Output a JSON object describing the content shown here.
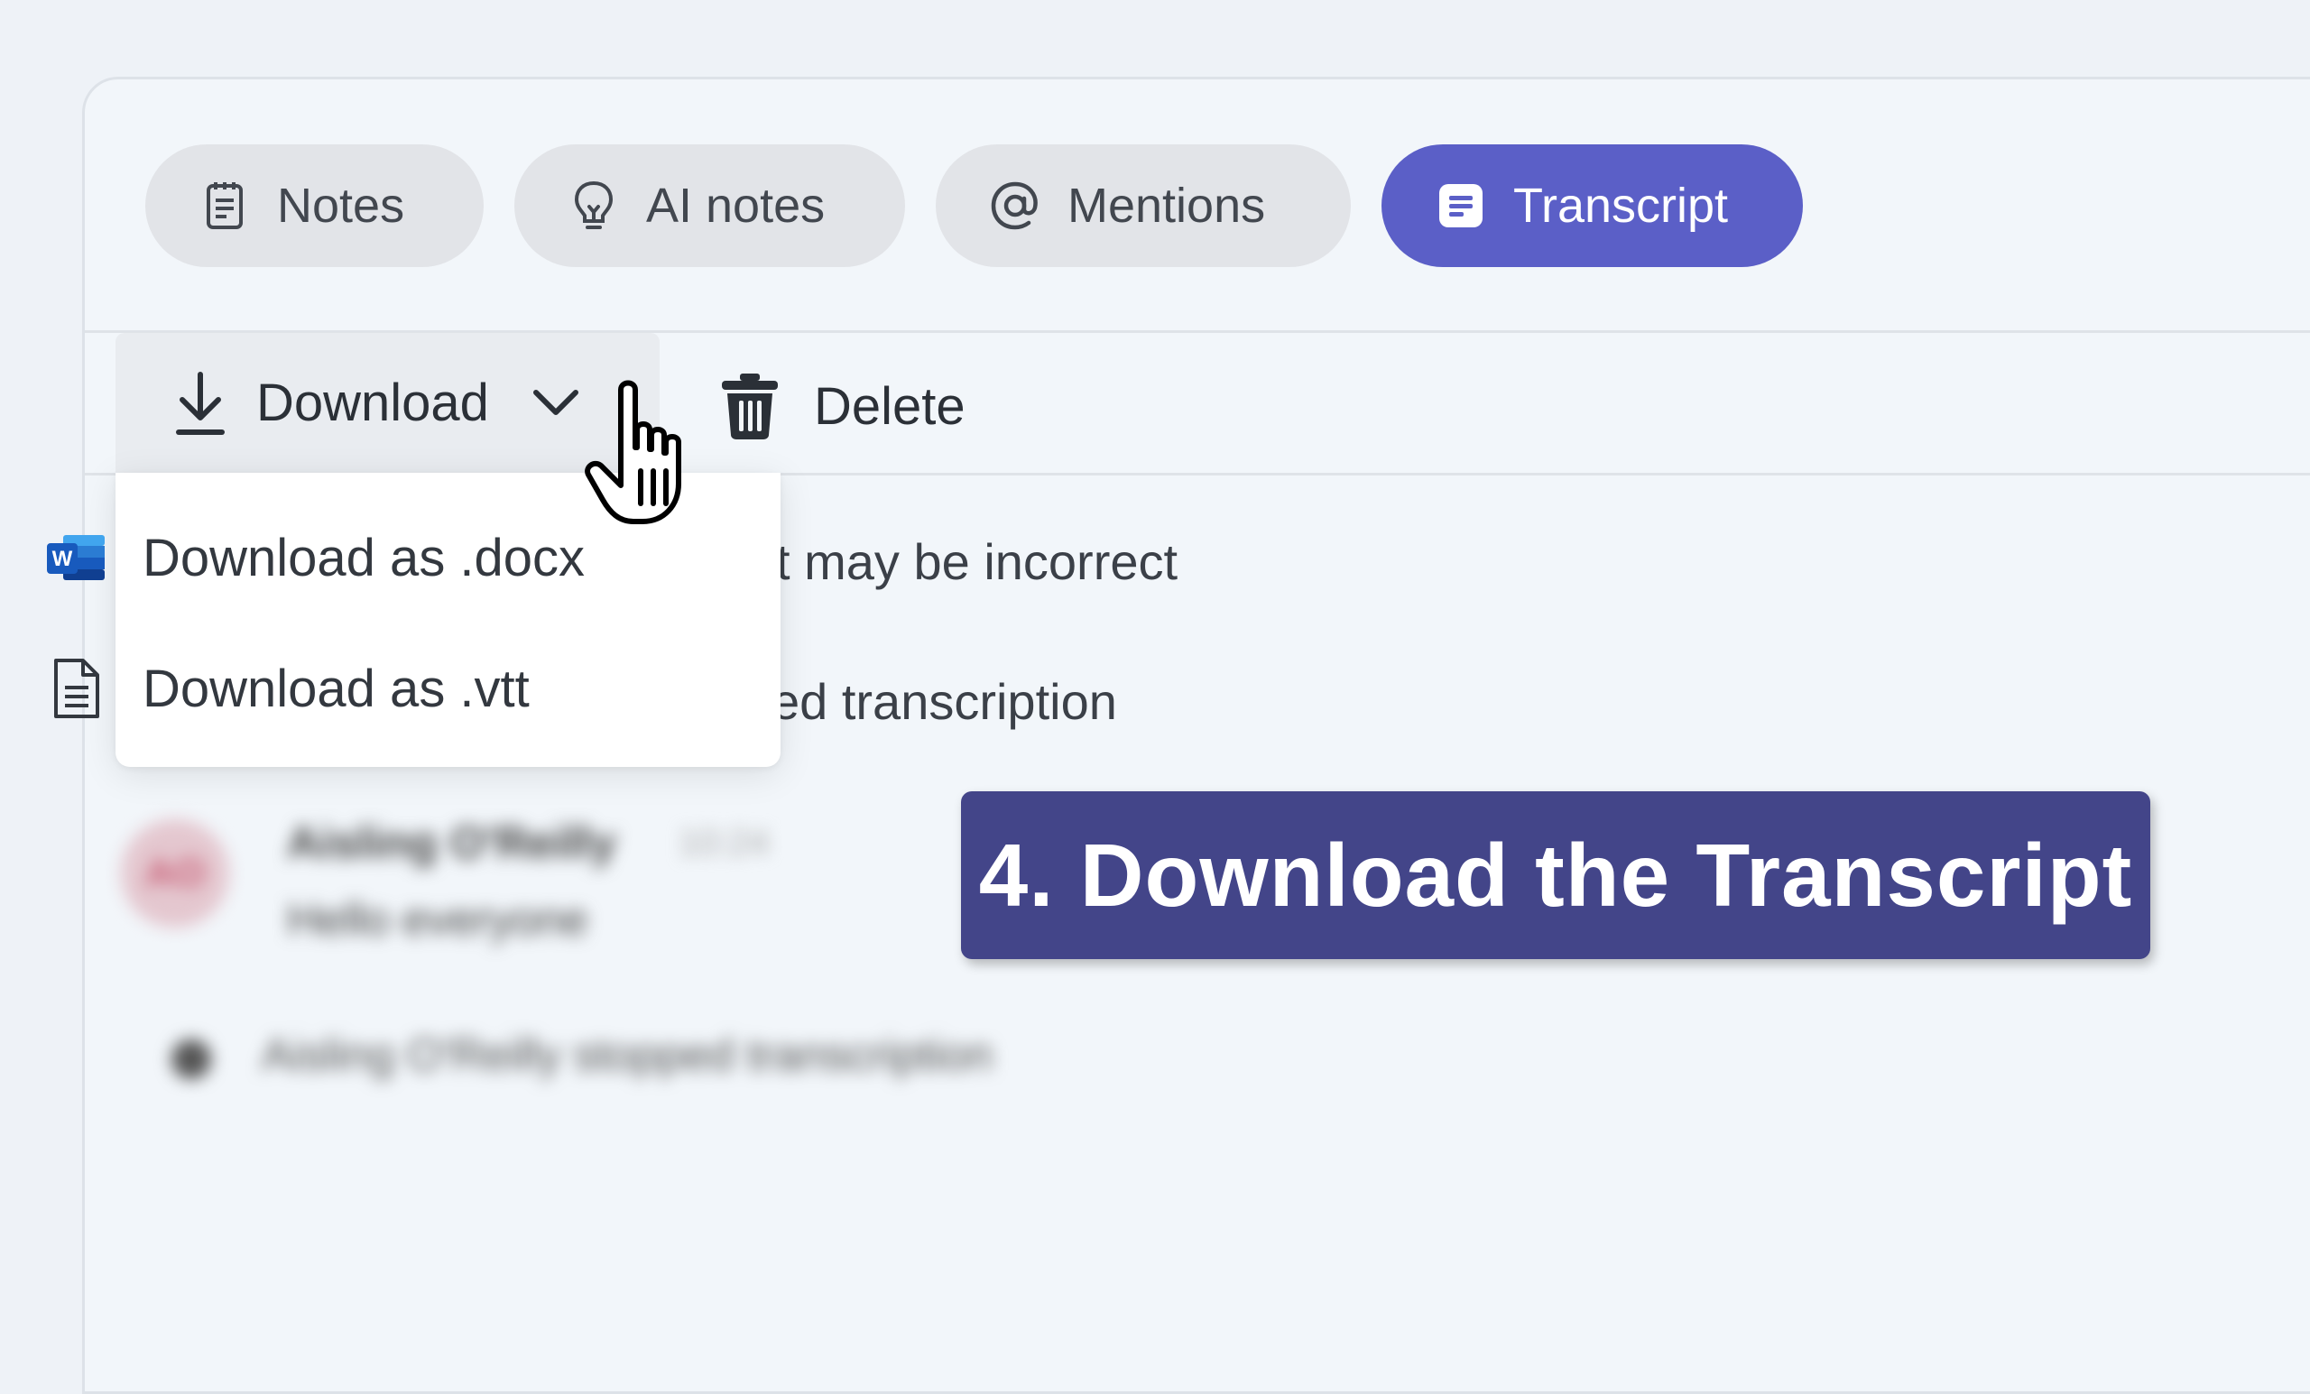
{
  "tabs": [
    {
      "label": "Notes",
      "icon": "notes-icon"
    },
    {
      "label": "AI notes",
      "icon": "lightbulb-icon"
    },
    {
      "label": "Mentions",
      "icon": "at-icon"
    },
    {
      "label": "Transcript",
      "icon": "transcript-icon",
      "active": true
    }
  ],
  "toolbar": {
    "download_label": "Download",
    "delete_label": "Delete"
  },
  "download_menu": {
    "items": [
      {
        "label": "Download as .docx",
        "icon": "word-icon"
      },
      {
        "label": "Download as .vtt",
        "icon": "file-icon"
      }
    ]
  },
  "background_text": {
    "line1": "t may be incorrect",
    "line2": "ed transcription"
  },
  "transcript": {
    "avatar_initials": "AO",
    "speaker": "Aisling O'Reilly",
    "time": "10:24",
    "message": "Hello everyone",
    "system_event": "Aisling O'Reilly stopped transcription"
  },
  "callout": {
    "text": "4. Download the Transcript"
  },
  "colors": {
    "accent": "#5b5fc7",
    "callout_bg": "#434589",
    "tab_bg": "#e2e4e8",
    "page_bg": "#f2f6fa"
  }
}
